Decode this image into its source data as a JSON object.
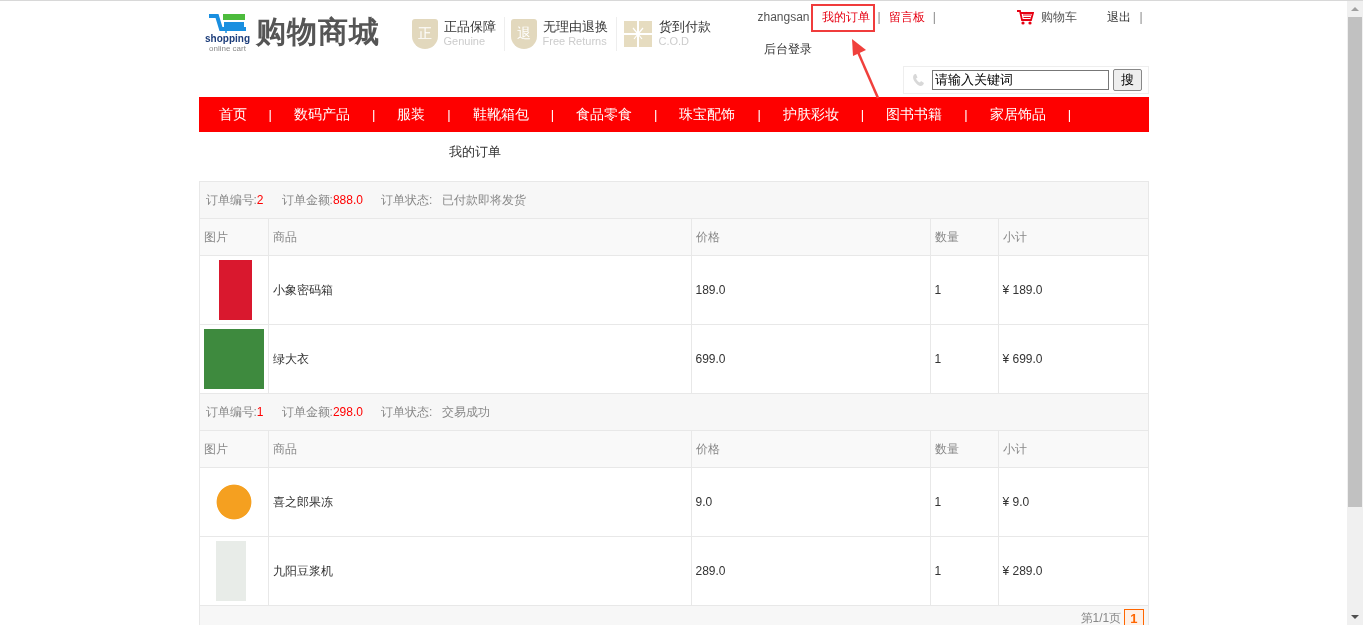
{
  "header": {
    "logo": {
      "word": "shopping",
      "tagline": "online cart",
      "brand": "购物商城"
    },
    "badges": [
      {
        "kind": "shield",
        "emblem": "正",
        "title": "正品保障",
        "subtitle": "Genuine"
      },
      {
        "kind": "shield",
        "emblem": "退",
        "title": "无理由退换",
        "subtitle": "Free Returns"
      },
      {
        "kind": "gift",
        "title": "货到付款",
        "subtitle": "C.O.D"
      }
    ],
    "user": "zhangsan",
    "separator": "|",
    "links": [
      {
        "label": "我的订单",
        "highlighted": true
      },
      {
        "label": "留言板",
        "highlighted": true
      }
    ],
    "cart": "购物车",
    "logout": "退出",
    "admin": "后台登录",
    "search": {
      "value": "请输入关键词",
      "button": "搜"
    }
  },
  "nav": {
    "separator": "|",
    "items": [
      "首页",
      "数码产品",
      "服装",
      "鞋靴箱包",
      "食品零食",
      "珠宝配饰",
      "护肤彩妆",
      "图书书籍",
      "家居饰品"
    ]
  },
  "page_title": "我的订单",
  "orders": [
    {
      "columns": [
        "图片",
        "商品",
        "价格",
        "数量",
        "小计"
      ],
      "number_label": "订单编号:",
      "number": "2",
      "amount_label": "订单金额:",
      "amount": "888.0",
      "status_label": "订单状态:",
      "status": "已付款即将发货",
      "items": [
        {
          "kind": "luggage",
          "name": "小象密码箱",
          "price": "189.0",
          "quantity": "1",
          "subtotal": "¥ 189.0"
        },
        {
          "kind": "coat",
          "name": "绿大衣",
          "price": "699.0",
          "quantity": "1",
          "subtotal": "¥ 699.0"
        }
      ]
    },
    {
      "columns": [
        "图片",
        "商品",
        "价格",
        "数量",
        "小计"
      ],
      "number_label": "订单编号:",
      "number": "1",
      "amount_label": "订单金额:",
      "amount": "298.0",
      "status_label": "订单状态:",
      "status": "交易成功",
      "items": [
        {
          "kind": "jelly",
          "name": "喜之郎果冻",
          "price": "9.0",
          "quantity": "1",
          "subtotal": "¥ 9.0"
        },
        {
          "kind": "soymilk",
          "name": "九阳豆浆机",
          "price": "289.0",
          "quantity": "1",
          "subtotal": "¥ 289.0"
        }
      ]
    }
  ],
  "pagination": {
    "summary": "第1/1页",
    "pages": [
      {
        "label": "1",
        "selected": true
      }
    ]
  }
}
